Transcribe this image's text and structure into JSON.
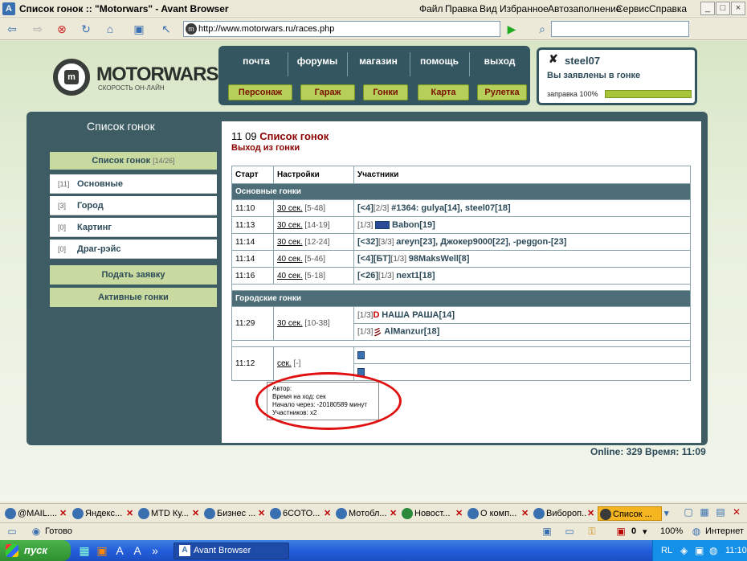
{
  "window": {
    "title": "Список гонок :: \"Motorwars\" - Avant Browser",
    "menu": [
      "Файл",
      "Правка",
      "Вид",
      "Избранное",
      "Автозаполнение",
      "Сервис",
      "Справка"
    ]
  },
  "address": {
    "url": "http://www.motorwars.ru/races.php"
  },
  "site": {
    "logo_name": "MOTORWARS.RU",
    "logo_slogan": "СКОРОСТЬ ОН-ЛАЙН",
    "nav_top": [
      "почта",
      "форумы",
      "магазин",
      "помощь",
      "выход"
    ],
    "nav_buttons": [
      "Персонаж",
      "Гараж",
      "Гонки",
      "Карта",
      "Рулетка"
    ],
    "user": {
      "name": "steel07",
      "status": "Вы заявлены в гонке",
      "fuel_label": "заправка 100%",
      "fuel_percent": 100
    }
  },
  "sidebar": {
    "title": "Список гонок",
    "header": {
      "label": "Список гонок",
      "count": "[14/26]"
    },
    "items": [
      {
        "count": "[11]",
        "label": "Основные"
      },
      {
        "count": "[3]",
        "label": "Город"
      },
      {
        "count": "[0]",
        "label": "Картинг"
      },
      {
        "count": "[0]",
        "label": "Драг-рэйс"
      }
    ],
    "buttons": [
      "Подать заявку",
      "Активные гонки"
    ]
  },
  "content": {
    "date": "11 09",
    "title": "Список гонок",
    "exit_link": "Выход из гонки",
    "columns": [
      "Старт",
      "Настройки",
      "Участники"
    ],
    "section_main": "Основные гонки",
    "section_city": "Городские гонки",
    "main_races": [
      {
        "start": "11:10",
        "time": "30 сек.",
        "range": "[5-48]",
        "prefix": "[<4]",
        "ratio": "[2/3]",
        "racers": "#1364: gulya[14], steel07[18]"
      },
      {
        "start": "11:13",
        "time": "30 сек.",
        "range": "[14-19]",
        "prefix": "",
        "ratio": "[1/3]",
        "racers": "Babon[19]"
      },
      {
        "start": "11:14",
        "time": "30 сек.",
        "range": "[12-24]",
        "prefix": "[<32]",
        "ratio": "[3/3]",
        "racers": "areyn[23], Джокер9000[22], -peggon-[23]"
      },
      {
        "start": "11:14",
        "time": "40 сек.",
        "range": "[5-46]",
        "prefix": "[<4][БТ]",
        "ratio": "[1/3]",
        "racers": "98MaksWell[8]"
      },
      {
        "start": "11:16",
        "time": "40 сек.",
        "range": "[5-18]",
        "prefix": "[<26]",
        "ratio": "[1/3]",
        "racers": "next1[18]"
      }
    ],
    "city_race": {
      "start": "11:29",
      "time": "30 сек.",
      "range": "[10-38]",
      "racer1_ratio": "[1/3]",
      "racer1": "НАША РАША[14]",
      "racer2_ratio": "[1/3]",
      "racer2": "AlManzur[18]"
    },
    "extra_race": {
      "start": "11:12",
      "time": "сек.",
      "range": "[-]"
    },
    "tooltip": [
      "Автор:",
      "Время на ход: сек",
      "Начало через: -20180589 минут",
      "Участников: x2"
    ],
    "online": "Online: 329  Время: 11:09"
  },
  "tabs": [
    "@MAIL....",
    "Яндекс...",
    "MTD Ку...",
    "Бизнес ...",
    "6СОТО...",
    "Мотобл...",
    "Новост...",
    "О комп...",
    "Вибороп...",
    "Список ..."
  ],
  "statusbar": {
    "text": "Готово",
    "zoom": "100%",
    "zone": "Интернет",
    "blocked": "0"
  },
  "taskbar": {
    "start": "пуск",
    "app": "Avant Browser",
    "lang": "RL",
    "clock": "11:10"
  }
}
